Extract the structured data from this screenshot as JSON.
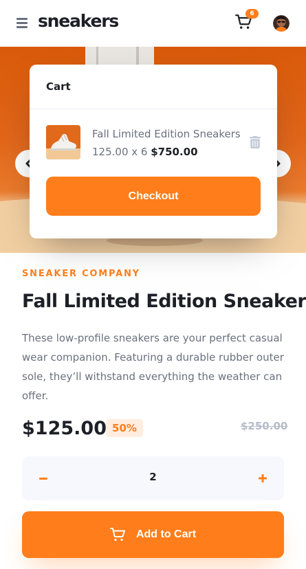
{
  "header": {
    "logo": "sneakers",
    "cart_count": "6"
  },
  "cart": {
    "title": "Cart",
    "item": {
      "name": "Fall Limited Edition Sneakers",
      "unit_price_qty": "125.00 x 6",
      "total": "$750.00"
    },
    "checkout_label": "Checkout"
  },
  "product": {
    "company": "SNEAKER COMPANY",
    "title": "Fall Limited Edition Sneakers",
    "description": "These low-profile sneakers are your perfect casual wear companion. Featuring a durable rubber outer sole, they’ll withstand everything the weather can offer.",
    "price": "$125.00",
    "discount": "50%",
    "original_price": "$250.00"
  },
  "quantity": {
    "value": "2"
  },
  "add_to_cart": {
    "label": "Add to Cart"
  },
  "colors": {
    "accent": "#ff7e1b",
    "accent_pale": "#ffede0",
    "dark_text": "#1d2026",
    "muted_text": "#69707d",
    "light_bg": "#f6f8fd"
  },
  "icons": [
    "menu-icon",
    "cart-icon",
    "avatar",
    "chevron-left-icon",
    "chevron-right-icon",
    "trash-icon",
    "minus-icon",
    "plus-icon"
  ]
}
